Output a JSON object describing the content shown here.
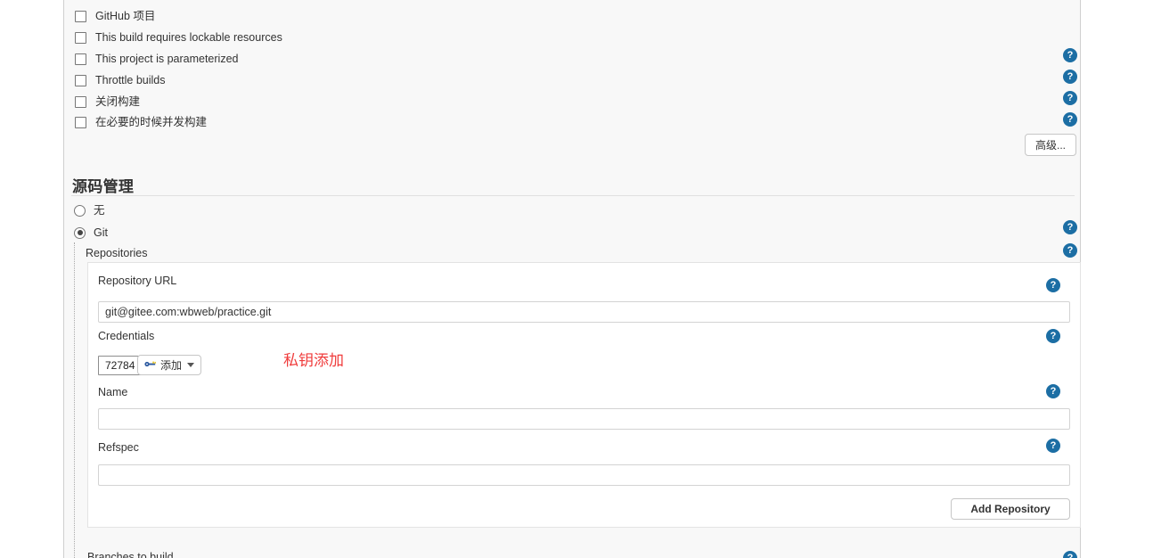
{
  "theme": {
    "accent_blue": "#1c6ea4",
    "content_bg": "#f8f8f8",
    "panel_bg": "#ffffff",
    "annotation_red": "#f03c3c",
    "border_gray": "#d0d0d0"
  },
  "checkboxes": [
    {
      "label": "GitHub 项目",
      "checked": false
    },
    {
      "label": "This build requires lockable resources",
      "checked": false
    },
    {
      "label": "This project is parameterized",
      "checked": false
    },
    {
      "label": "Throttle builds",
      "checked": false
    },
    {
      "label": "关闭构建",
      "checked": false
    },
    {
      "label": "在必要的时候并发构建",
      "checked": false
    }
  ],
  "help_icon": {
    "glyph": "?",
    "name": "help-icon"
  },
  "advanced_button": {
    "label": "高级..."
  },
  "scm_section": {
    "title": "源码管理",
    "radios": [
      {
        "label": "无",
        "selected": false
      },
      {
        "label": "Git",
        "selected": true
      }
    ],
    "repositories_label": "Repositories",
    "fields": {
      "repository_url": {
        "label": "Repository URL",
        "value": "git@gitee.com:wbweb/practice.git",
        "placeholder": ""
      },
      "credentials": {
        "label": "Credentials",
        "selected_value": "72784",
        "add_button_label": "添加",
        "add_button_icon": "key-icon"
      },
      "name": {
        "label": "Name",
        "value": "",
        "placeholder": ""
      },
      "refspec": {
        "label": "Refspec",
        "value": "",
        "placeholder": ""
      }
    },
    "add_repository_button": {
      "label": "Add Repository"
    },
    "next_section_label": "Branches to build"
  },
  "annotation": {
    "text": "私钥添加"
  }
}
